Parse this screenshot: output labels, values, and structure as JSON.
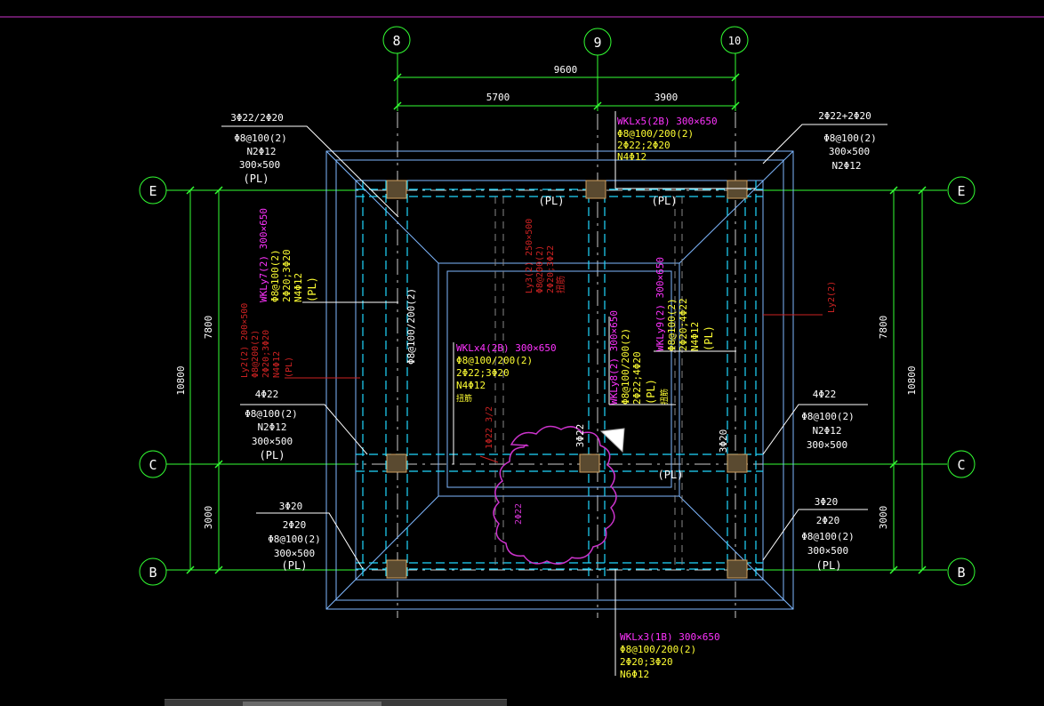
{
  "colors": {
    "background": "#000000",
    "grid_and_dims": "#33ff33",
    "beam": "#7fd1ff",
    "beam_dashed": "#20d8ff",
    "text": "#ffffff",
    "tag_magenta": "#ff33ff",
    "tag_yellow": "#ffff33",
    "red_text": "#cc2222",
    "column": "#aa8844",
    "border_line": "#cc33cc",
    "cloud": "#cc33cc"
  },
  "axes": {
    "a8": "8",
    "a9": "9",
    "a10": "10",
    "aE": "E",
    "aC": "C",
    "aB": "B"
  },
  "dims": {
    "top_total": "9600",
    "top_left": "5700",
    "top_right": "3900",
    "left_upper": "7800",
    "left_total": "10800",
    "left_lower": "3000",
    "right_upper": "7800",
    "right_total": "10800",
    "right_lower": "3000"
  },
  "pl": {
    "top_left": "(PL)",
    "top_mid": "(PL)",
    "top_right": "(PL)",
    "mid_right": "(PL)",
    "bot_right": "(PL)"
  },
  "notes": {
    "tl": [
      "3Φ22/2Φ20",
      "Φ8@100(2)",
      "N2Φ12",
      "300×500",
      "(PL)"
    ],
    "tr": [
      "2Φ22+2Φ20",
      "Φ8@100(2)",
      "300×500",
      "N2Φ12"
    ],
    "ml": [
      "4Φ22",
      "Φ8@100(2)",
      "N2Φ12",
      "300×500",
      "(PL)"
    ],
    "mr": [
      "4Φ22",
      "Φ8@100(2)",
      "N2Φ12",
      "300×500"
    ],
    "bl": [
      "3Φ20",
      "2Φ20",
      "Φ8@100(2)",
      "300×500",
      "(PL)"
    ],
    "br": [
      "3Φ20",
      "2Φ20",
      "Φ8@100(2)",
      "300×500"
    ],
    "wklx5": [
      "WKLx5(2B) 300×650",
      "Φ8@100/200(2)",
      "2Φ22;2Φ20",
      "N4Φ12"
    ],
    "wklx4": [
      "WKLx4(2B) 300×650",
      "Φ8@100/200(2)",
      "2Φ22;3Φ20",
      "N4Φ12",
      "扭筋"
    ],
    "wklx3": [
      "WKLx3(1B) 300×650",
      "Φ8@100/200(2)",
      "2Φ20;3Φ20",
      "N6Φ12"
    ],
    "wkly7": [
      "WKLy7(2) 300×650",
      "Φ8@100(2)",
      "2Φ20;3Φ20",
      "N4Φ12",
      "(PL)"
    ],
    "wkly8": [
      "WKLy8(2) 300×650",
      "Φ8@100/200(2)",
      "2Φ22;4Φ20",
      "(PL)",
      "扭筋"
    ],
    "wkly9": [
      "WKLy9(2) 300×650",
      "Φ8@100(2)",
      "2Φ20;4Φ22",
      "N4Φ12",
      "(PL)"
    ],
    "ly2": [
      "Ly2(2) 200×500",
      "Φ8@200(2)",
      "2Φ20;3Φ20",
      "N4Φ12",
      "(PL)"
    ],
    "ly3": [
      "Ly3(2) 250×500",
      "Φ8@200(2)",
      "2Φ20;3Φ22",
      "扭筋"
    ],
    "ly_right": "Ly2(2)",
    "v3022": "3Φ22",
    "h3020": "3Φ20",
    "red_small": "1Φ22 3/2",
    "cloud_text": "2Φ22"
  }
}
